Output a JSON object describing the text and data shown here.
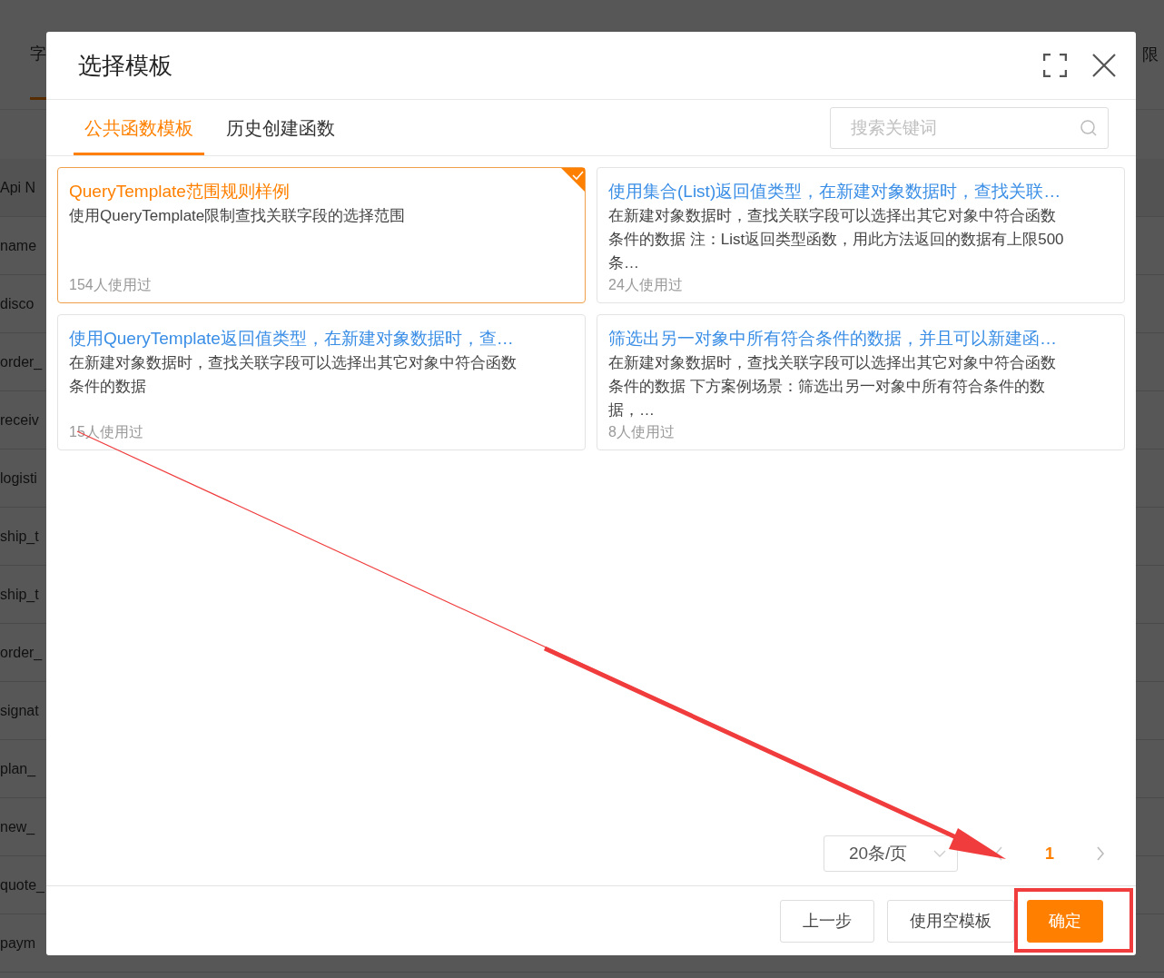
{
  "background": {
    "tab": "字",
    "right_tab": "限",
    "rows": [
      "Api N",
      "name",
      "disco",
      "order_",
      "receiv",
      "logisti",
      "ship_t",
      "ship_t",
      "order_",
      "signat",
      "plan_",
      "new_",
      "quote_",
      "paym"
    ]
  },
  "dialog": {
    "title": "选择模板"
  },
  "tabs": [
    {
      "label": "公共函数模板",
      "selected": true
    },
    {
      "label": "历史创建函数",
      "selected": false
    }
  ],
  "search": {
    "placeholder": "搜索关键词"
  },
  "templates": [
    {
      "title": "QueryTemplate范围规则样例",
      "description": "使用QueryTemplate限制查找关联字段的选择范围",
      "usage": "154人使用过",
      "selected": true
    },
    {
      "title": "使用集合(List)返回值类型，在新建对象数据时，查找关联…",
      "description": "在新建对象数据时，查找关联字段可以选择出其它对象中符合函数条件的数据 注：List返回类型函数，用此方法返回的数据有上限500条…",
      "usage": "24人使用过",
      "selected": false
    },
    {
      "title": "使用QueryTemplate返回值类型，在新建对象数据时，查…",
      "description": "在新建对象数据时，查找关联字段可以选择出其它对象中符合函数条件的数据",
      "usage": "15人使用过",
      "selected": false
    },
    {
      "title": "筛选出另一对象中所有符合条件的数据，并且可以新建函…",
      "description": "在新建对象数据时，查找关联字段可以选择出其它对象中符合函数条件的数据 下方案例场景：筛选出另一对象中所有符合条件的数据，…",
      "usage": "8人使用过",
      "selected": false
    }
  ],
  "pagination": {
    "page_size": "20条/页",
    "pages": [
      {
        "label": "1",
        "selected": true
      }
    ]
  },
  "buttons": [
    {
      "label": "上一步",
      "kind": "default"
    },
    {
      "label": "使用空模板",
      "kind": "default"
    },
    {
      "label": "确定",
      "kind": "primary"
    }
  ]
}
